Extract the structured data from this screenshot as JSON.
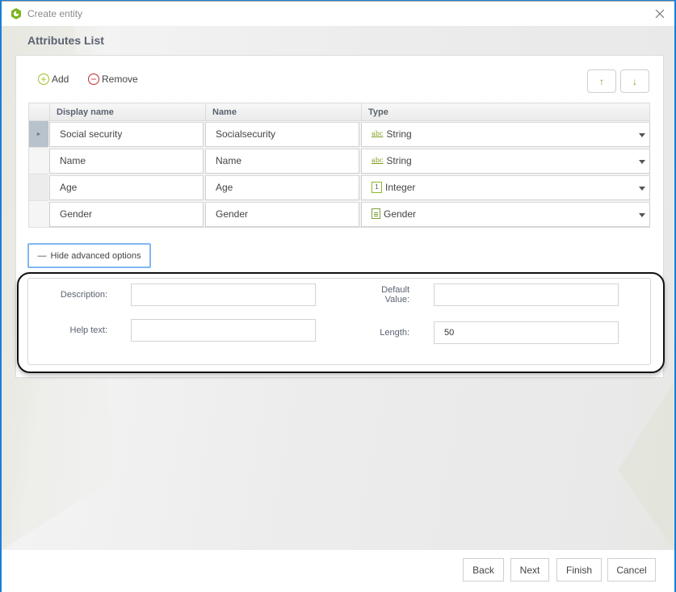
{
  "window": {
    "title": "Create entity",
    "accent_color": "#1a7fd4",
    "brand_color": "#7ab51d"
  },
  "section": {
    "title": "Attributes List"
  },
  "toolbar": {
    "add_label": "Add",
    "remove_label": "Remove",
    "move_up_glyph": "↑",
    "move_down_glyph": "↓"
  },
  "grid": {
    "columns": [
      "Display name",
      "Name",
      "Type"
    ],
    "rows": [
      {
        "display_name": "Social security",
        "name": "Socialsecurity",
        "type": "String",
        "type_icon": "abc-string-icon",
        "selected": true
      },
      {
        "display_name": "Name",
        "name": "Name",
        "type": "String",
        "type_icon": "abc-string-icon",
        "selected": false
      },
      {
        "display_name": "Age",
        "name": "Age",
        "type": "Integer",
        "type_icon": "integer-icon",
        "selected": false
      },
      {
        "display_name": "Gender",
        "name": "Gender",
        "type": "Gender",
        "type_icon": "enumeration-icon",
        "selected": false
      }
    ],
    "type_icon_text": {
      "abc": "abc",
      "integer": "1"
    },
    "row_selector_glyph": "►"
  },
  "advanced": {
    "toggle_label": "Hide advanced options",
    "toggle_glyph": "—",
    "fields": {
      "description": {
        "label": "Description:",
        "value": ""
      },
      "help_text": {
        "label": "Help text:",
        "value": ""
      },
      "default_value": {
        "label": "Default Value:",
        "label_line1": "Default",
        "label_line2": "Value:",
        "value": ""
      },
      "length": {
        "label": "Length:",
        "value": "50"
      }
    }
  },
  "footer": {
    "back_label": "Back",
    "next_label": "Next",
    "finish_label": "Finish",
    "cancel_label": "Cancel"
  }
}
